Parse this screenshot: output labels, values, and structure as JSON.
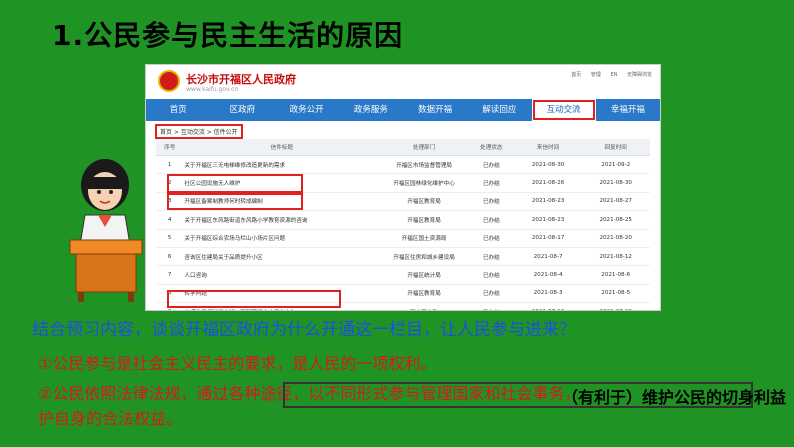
{
  "slide": {
    "title": "1.公民参与民主生活的原因",
    "question": "结合预习内容，谈谈开福区政府为什么开通这一栏目，让人民参与进来？",
    "point1": "①公民参与是社会主义民主的要求，是人民的一项权利。",
    "point2": "②公民依照法律法规，通过各种途径，以不同形式参与管理国家和社会事务，",
    "point3": "护自身的合法权益。",
    "overlay_text": "（有利于）维护公民的切身利益"
  },
  "site": {
    "name": "长沙市开福区人民政府",
    "url": "www.kaifu.gov.cn",
    "top_links": [
      "首页",
      "管理",
      "EN",
      "无障碍浏览"
    ],
    "nav": [
      "首页",
      "区政府",
      "政务公开",
      "政务服务",
      "数据开福",
      "解读回应",
      "互动交流",
      "幸福开福"
    ],
    "active_nav": "互动交流",
    "breadcrumb": "首页 > 互动交流 > 信件公开",
    "columns": [
      "序号",
      "信件标题",
      "处理部门",
      "处理状态",
      "来信时间",
      "回复时间"
    ],
    "rows": [
      [
        "1",
        "关于开福区三无电梯维修改造更新的需求",
        "开福区市场监督管理局",
        "已办结",
        "2021-08-30",
        "2021-09-2"
      ],
      [
        "2",
        "社区公园设施无人维护",
        "开福区园林绿化维护中心",
        "已办结",
        "2021-08-26",
        "2021-08-30"
      ],
      [
        "3",
        "开福区备案制教师何时转成编制",
        "开福区教育局",
        "已办结",
        "2021-08-23",
        "2021-08-27"
      ],
      [
        "4",
        "关于开福区东风路街道东风路小学教育资源的咨询",
        "开福区教育局",
        "已办结",
        "2021-08-23",
        "2021-08-25"
      ],
      [
        "5",
        "关于开福区综合农场马栏山小场片区问题",
        "开福区国土资源局",
        "已办结",
        "2021-08-17",
        "2021-08-20"
      ],
      [
        "6",
        "咨询区住建局关于品质提升小区",
        "开福区住房和城乡建设局",
        "已办结",
        "2021-08-7",
        "2021-08-12"
      ],
      [
        "7",
        "人口咨询",
        "开福区统计局",
        "已办结",
        "2021-08-4",
        "2021-08-6"
      ],
      [
        "8",
        "转学问题",
        "开福区教育局",
        "已办结",
        "2021-08-3",
        "2021-08-5"
      ],
      [
        "9",
        "交通信号灯时间太短，腿脚不便人士怎么办？",
        "区交警大队",
        "已办结",
        "2021-07-16",
        "2021-07-20"
      ]
    ]
  }
}
